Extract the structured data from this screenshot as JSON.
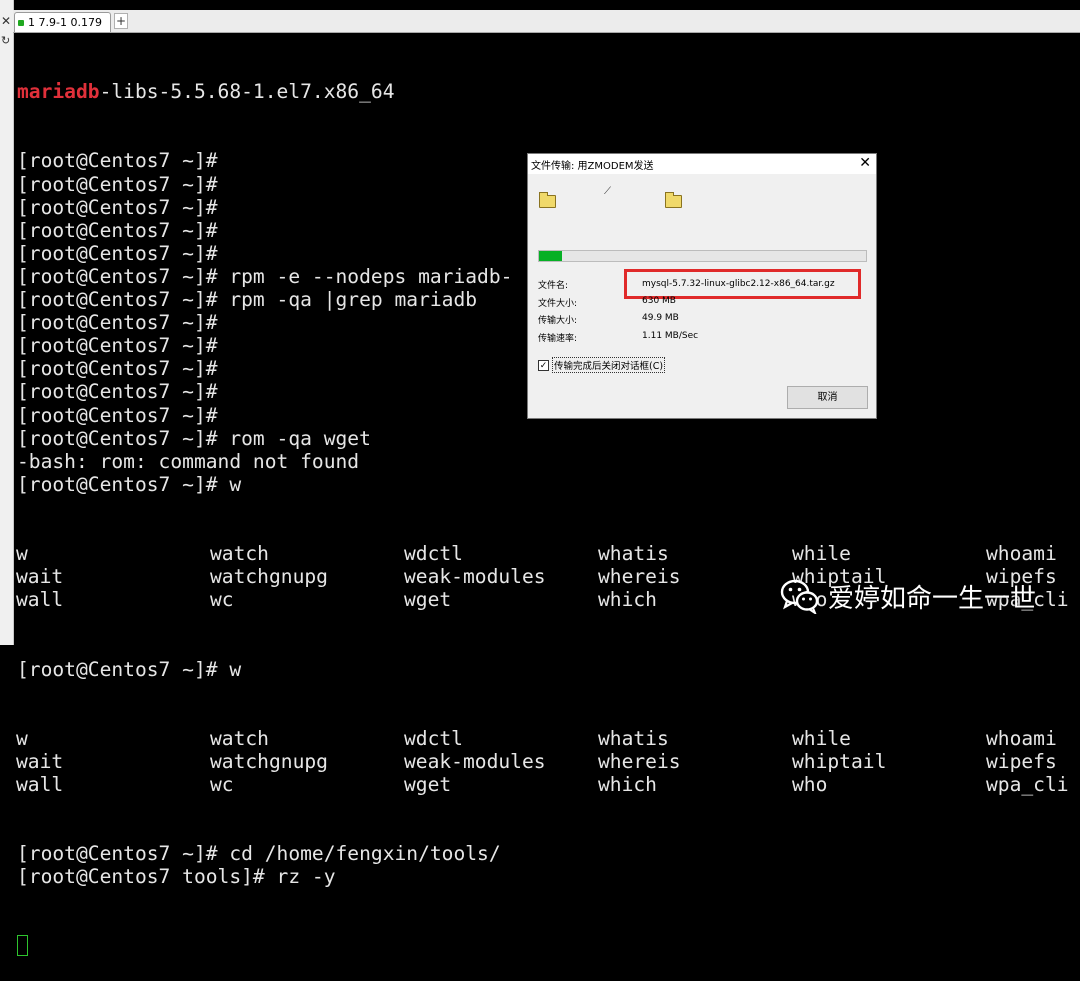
{
  "sidebar": {
    "close_glyph": "✕",
    "arrow_glyph": "↻"
  },
  "tabs": [
    {
      "label": "1 7.9-1 0.179",
      "status_color": "#1fa81f"
    }
  ],
  "tab_add_label": "+",
  "terminal": {
    "line1_red": "mariadb",
    "line1_rest": "-libs-5.5.68-1.el7.x86_64",
    "lines_a": [
      "[root@Centos7 ~]#",
      "[root@Centos7 ~]#",
      "[root@Centos7 ~]#",
      "[root@Centos7 ~]#",
      "[root@Centos7 ~]#",
      "[root@Centos7 ~]# rpm -e --nodeps mariadb-",
      "[root@Centos7 ~]# rpm -qa |grep mariadb",
      "[root@Centos7 ~]#",
      "[root@Centos7 ~]#",
      "[root@Centos7 ~]#",
      "[root@Centos7 ~]#",
      "[root@Centos7 ~]#",
      "[root@Centos7 ~]# rom -qa wget",
      "-bash: rom: command not found",
      "[root@Centos7 ~]# w"
    ],
    "completion_block_1": [
      [
        "w",
        "watch",
        "wdctl",
        "whatis",
        "while",
        "whoami"
      ],
      [
        "wait",
        "watchgnupg",
        "weak-modules",
        "whereis",
        "whiptail",
        "wipefs"
      ],
      [
        "wall",
        "wc",
        "wget",
        "which",
        "who",
        "wpa_cli"
      ]
    ],
    "prompt_w2": "[root@Centos7 ~]# w",
    "completion_block_2": [
      [
        "w",
        "watch",
        "wdctl",
        "whatis",
        "while",
        "whoami"
      ],
      [
        "wait",
        "watchgnupg",
        "weak-modules",
        "whereis",
        "whiptail",
        "wipefs"
      ],
      [
        "wall",
        "wc",
        "wget",
        "which",
        "who",
        "wpa_cli"
      ]
    ],
    "lines_b": [
      "[root@Centos7 ~]# cd /home/fengxin/tools/",
      "[root@Centos7 tools]# rz -y"
    ]
  },
  "dialog": {
    "title": "文件传输: 用ZMODEM发送",
    "close_glyph": "✕",
    "progress": 0.07,
    "progress_color": "#06b025",
    "filename_label": "文件名:",
    "filename_value": "mysql-5.7.32-linux-glibc2.12-x86_64.tar.gz",
    "filesize_label": "文件大小:",
    "filesize_value": "630 MB",
    "transferred_label": "传输大小:",
    "transferred_value": "49.9 MB",
    "speed_label": "传输速率:",
    "speed_value": "1.11 MB/Sec",
    "checkbox_checked": true,
    "checkbox_label": "传输完成后关闭对话框(C)",
    "cancel_label": "取消",
    "transfer_icon": "⟋",
    "check_glyph": "✓"
  },
  "watermark": {
    "text": "爱婷如命一生一世",
    "icon": "wechat-icon"
  }
}
